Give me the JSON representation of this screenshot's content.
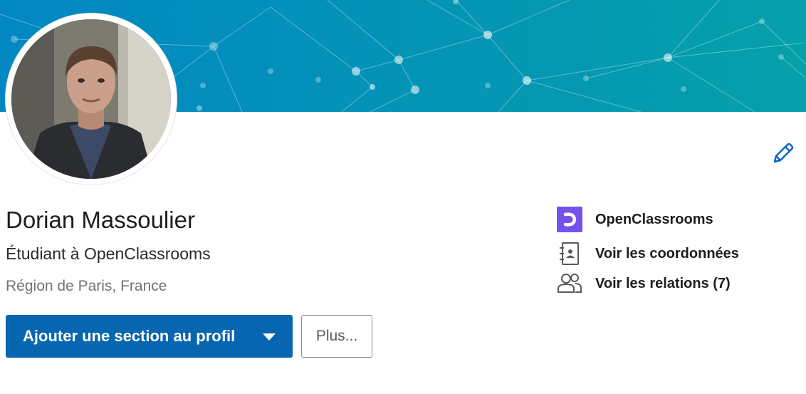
{
  "colors": {
    "banner_start": "#0287c3",
    "banner_end": "#05a0aa",
    "primary": "#0866b0",
    "edit_icon": "#0a66c2",
    "openclassrooms_brand": "#7451eb"
  },
  "profile": {
    "name": "Dorian Massoulier",
    "headline": "Étudiant à OpenClassrooms",
    "location": "Région de Paris, France",
    "avatar_icon": "profile-photo",
    "edit_icon": "pencil-icon"
  },
  "actions": {
    "add_section_label": "Ajouter une section au profil",
    "add_section_icon": "caret-down-icon",
    "more_label": "Plus..."
  },
  "sidebar": {
    "items": [
      {
        "label": "OpenClassrooms",
        "icon": "openclassrooms-logo-icon"
      },
      {
        "label": "Voir les coordonnées",
        "icon": "contact-book-icon"
      },
      {
        "label": "Voir les relations (7)",
        "icon": "people-icon"
      }
    ]
  }
}
